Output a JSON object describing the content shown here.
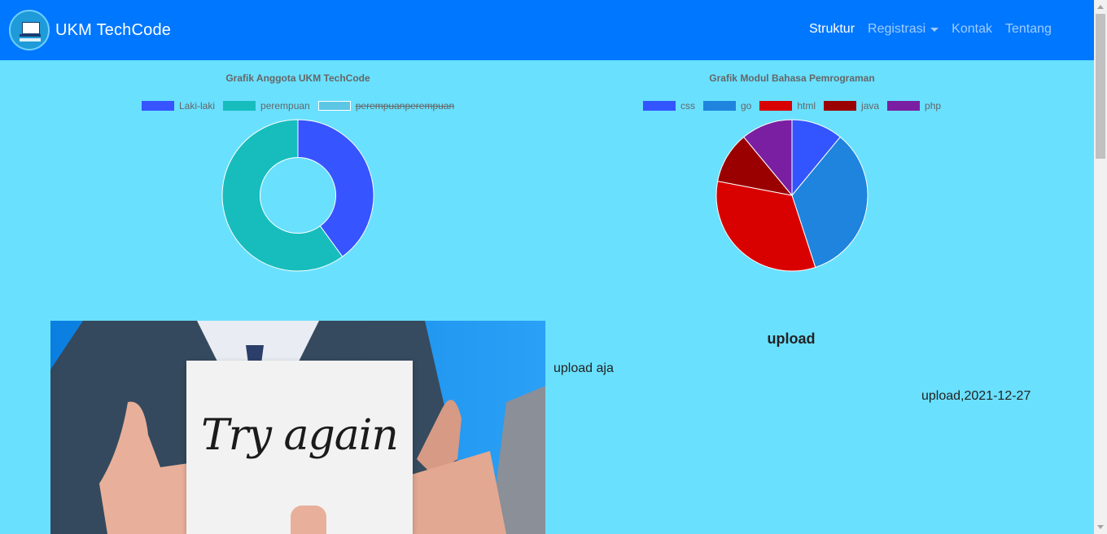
{
  "navbar": {
    "brand": "UKM TechCode",
    "links": [
      {
        "label": "Struktur"
      },
      {
        "label": "Registrasi"
      },
      {
        "label": "Kontak"
      },
      {
        "label": "Tentang"
      }
    ]
  },
  "chart_data": [
    {
      "type": "pie",
      "variant": "doughnut",
      "title": "Grafik Anggota UKM TechCode",
      "categories": [
        "Laki-laki",
        "perempuan",
        "perempuanperempuan"
      ],
      "values": [
        40,
        60,
        0
      ],
      "hidden": [
        false,
        false,
        true
      ],
      "colors": [
        "#3654ff",
        "#17bdbd",
        "#5cc6e4"
      ],
      "legend": "top"
    },
    {
      "type": "pie",
      "title": "Grafik Modul Bahasa Pemrograman",
      "categories": [
        "css",
        "go",
        "html",
        "java",
        "php"
      ],
      "values": [
        11,
        34,
        33,
        11,
        11
      ],
      "colors": [
        "#3355ff",
        "#1e84de",
        "#d90000",
        "#9b0000",
        "#7b1fa2"
      ],
      "legend": "top"
    }
  ],
  "post": {
    "image_text": "Try again",
    "title": "upload",
    "description": "upload aja",
    "meta": "upload,2021-12-27"
  },
  "colors": {
    "navbar": "#0077ff",
    "page_background": "#69e0fe"
  }
}
